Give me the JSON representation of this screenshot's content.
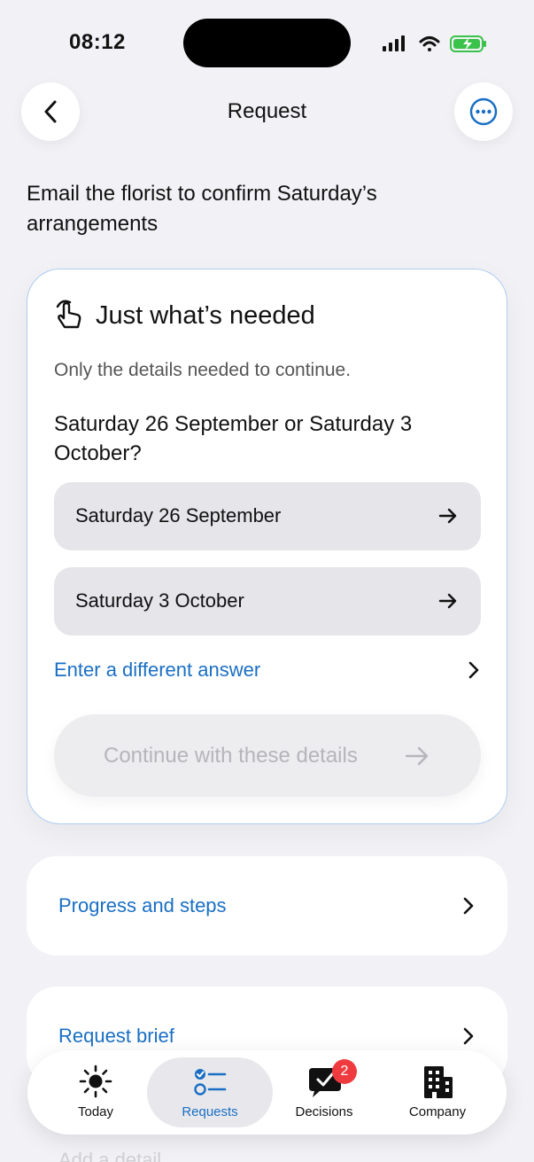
{
  "status_bar": {
    "time": "08:12"
  },
  "header": {
    "title": "Request"
  },
  "request": {
    "heading": "Email the florist to confirm Saturday’s arrangements"
  },
  "card": {
    "title": "Just what’s needed",
    "subtitle": "Only the details needed to continue.",
    "question": "Saturday 26 September or Saturday 3 October?",
    "options": [
      {
        "label": "Saturday 26 September"
      },
      {
        "label": "Saturday 3 October"
      }
    ],
    "different_answer": "Enter a different answer",
    "continue_label": "Continue with these details"
  },
  "rows": [
    {
      "label": "Progress and steps"
    },
    {
      "label": "Request brief"
    }
  ],
  "faded_row": {
    "label": "Add a detail"
  },
  "tabs": [
    {
      "label": "Today",
      "icon": "sun-icon"
    },
    {
      "label": "Requests",
      "icon": "checklist-icon",
      "active": true
    },
    {
      "label": "Decisions",
      "icon": "chat-check-icon",
      "badge": "2"
    },
    {
      "label": "Company",
      "icon": "building-icon"
    }
  ],
  "colors": {
    "accent": "#1a6fc4",
    "badge": "#ef3b3f",
    "background": "#f2f2f6",
    "card_border": "#aecdf0"
  }
}
